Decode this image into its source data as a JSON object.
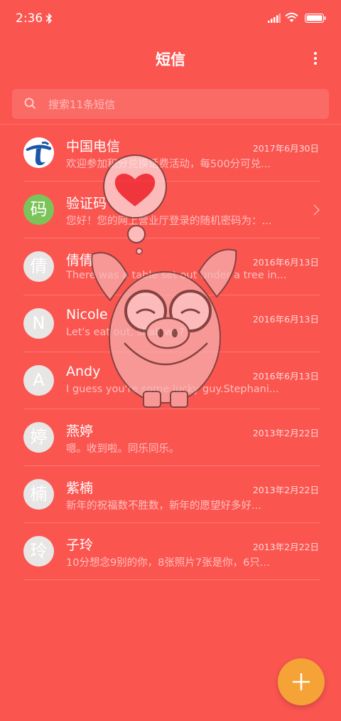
{
  "status_bar": {
    "time": "2:36"
  },
  "header": {
    "title": "短信"
  },
  "search": {
    "placeholder": "搜索11条短信"
  },
  "messages": [
    {
      "avatar": "",
      "sender": "中国电信",
      "date": "2017年6月30日",
      "preview": "欢迎参加积分兑换话费活动，每500分可兑..."
    },
    {
      "avatar": "码",
      "sender": "验证码",
      "date": "",
      "preview": "您好！您的网上营业厅登录的随机密码为：..."
    },
    {
      "avatar": "倩",
      "sender": "倩倩",
      "date": "2016年6月13日",
      "preview": "There was a table set out under a tree in..."
    },
    {
      "avatar": "N",
      "sender": "Nicole",
      "date": "2016年6月13日",
      "preview": "Let's eat out, shall we?"
    },
    {
      "avatar": "A",
      "sender": "Andy",
      "date": "2016年6月13日",
      "preview": "I guess you're some lucky guy.Stephani..."
    },
    {
      "avatar": "婷",
      "sender": "燕婷",
      "date": "2013年2月22日",
      "preview": "嗯。收到啦。同乐同乐。"
    },
    {
      "avatar": "楠",
      "sender": "紫楠",
      "date": "2013年2月22日",
      "preview": "新年的祝福数不胜数，新年的愿望好多好..."
    },
    {
      "avatar": "玲",
      "sender": "子玲",
      "date": "2013年2月22日",
      "preview": "10分想念9别的你，8张照片7张是你，6只..."
    }
  ],
  "colors": {
    "background": "#FB5550",
    "fab": "#F5A336",
    "verify_avatar": "#7CC35A"
  },
  "icons": [
    "bluetooth-icon",
    "signal-icon",
    "wifi-icon",
    "battery-icon",
    "more-icon",
    "search-icon",
    "chevron-right-icon",
    "plus-icon"
  ]
}
